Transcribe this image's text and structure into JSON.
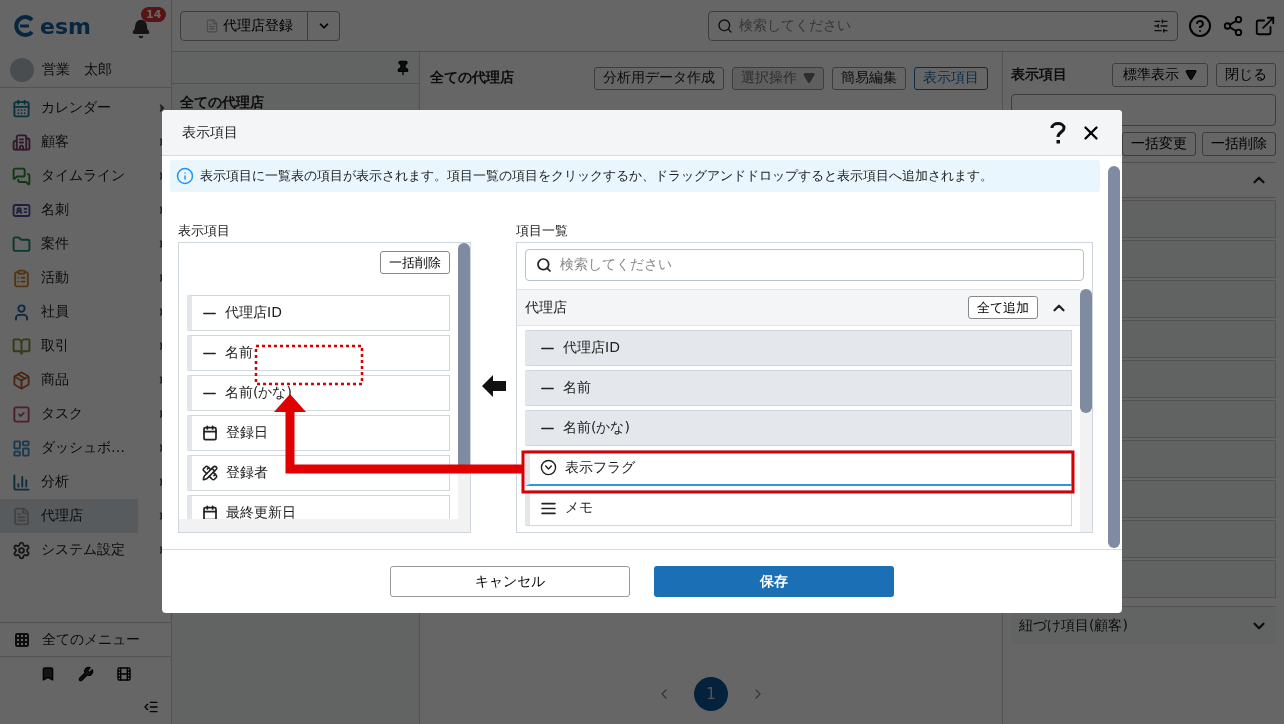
{
  "sidebar": {
    "logo": "esm",
    "notification_count": "14",
    "user": {
      "name": "営業　太郎"
    },
    "items": [
      {
        "label": "カレンダー",
        "kind": "calendar",
        "selected": false
      },
      {
        "label": "顧客",
        "kind": "building",
        "selected": false
      },
      {
        "label": "タイムライン",
        "kind": "chat",
        "selected": false
      },
      {
        "label": "名刺",
        "kind": "card",
        "selected": false
      },
      {
        "label": "案件",
        "kind": "folder",
        "selected": false
      },
      {
        "label": "活動",
        "kind": "clipboard",
        "selected": false
      },
      {
        "label": "社員",
        "kind": "person",
        "selected": false
      },
      {
        "label": "取引",
        "kind": "book",
        "selected": false
      },
      {
        "label": "商品",
        "kind": "package",
        "selected": false
      },
      {
        "label": "タスク",
        "kind": "task",
        "selected": false
      },
      {
        "label": "ダッシュボ…",
        "kind": "dashboard",
        "selected": false
      },
      {
        "label": "分析",
        "kind": "chart",
        "selected": false
      },
      {
        "label": "代理店",
        "kind": "document",
        "selected": true
      },
      {
        "label": "システム設定",
        "kind": "settings",
        "selected": false
      }
    ],
    "all_menu": "全てのメニュー"
  },
  "topbar": {
    "register_button": "代理店登録",
    "search": {
      "placeholder": "検索してください"
    }
  },
  "list_panel": {
    "title": "全ての代理店"
  },
  "main": {
    "title": "全ての代理店",
    "buttons": [
      {
        "label": "分析用データ作成",
        "disabled": false,
        "active": false,
        "dropdown": false
      },
      {
        "label": "選択操作",
        "disabled": true,
        "active": false,
        "dropdown": true
      },
      {
        "label": "簡易編集",
        "disabled": false,
        "active": false,
        "dropdown": false
      },
      {
        "label": "表示項目",
        "disabled": false,
        "active": true,
        "dropdown": false
      }
    ],
    "pagination": {
      "pages": [
        {
          "label": "1",
          "selected": true
        }
      ]
    }
  },
  "right_panel": {
    "title": "表示項目",
    "view_select": "標準表示",
    "close_button": "閉じる",
    "buttons": [
      "一括変更",
      "一括削除"
    ],
    "section": {
      "expanded": true
    },
    "linked_section": {
      "title": "紐づけ項目(顧客)",
      "expanded": false
    }
  },
  "dialog": {
    "title": "表示項目",
    "info": "表示項目に一覧表の項目が表示されます。項目一覧の項目をクリックするか、ドラッグアンドドロップすると表示項目へ追加されます。",
    "selected_panel": {
      "title": "表示項目",
      "clear_button": "一括削除",
      "items": [
        {
          "label": "代理店ID",
          "kind": "text"
        },
        {
          "label": "名前",
          "kind": "text"
        },
        {
          "label": "名前(かな)",
          "kind": "text"
        },
        {
          "label": "登録日",
          "kind": "date"
        },
        {
          "label": "登録者",
          "kind": "user"
        },
        {
          "label": "最終更新日",
          "kind": "date"
        }
      ]
    },
    "field_panel": {
      "title": "項目一覧",
      "search": {
        "placeholder": "検索してください"
      },
      "group": {
        "title": "代理店",
        "add_all_button": "全て追加",
        "expanded": true,
        "items": [
          {
            "label": "代理店ID",
            "kind": "text",
            "added": true,
            "selected": false
          },
          {
            "label": "名前",
            "kind": "text",
            "added": true,
            "selected": false
          },
          {
            "label": "名前(かな)",
            "kind": "text",
            "added": true,
            "selected": false
          },
          {
            "label": "表示フラグ",
            "kind": "select",
            "added": false,
            "selected": true
          },
          {
            "label": "メモ",
            "kind": "memo",
            "added": false,
            "selected": false
          }
        ]
      }
    },
    "cancel_button": "キャンセル",
    "save_button": "保存"
  }
}
